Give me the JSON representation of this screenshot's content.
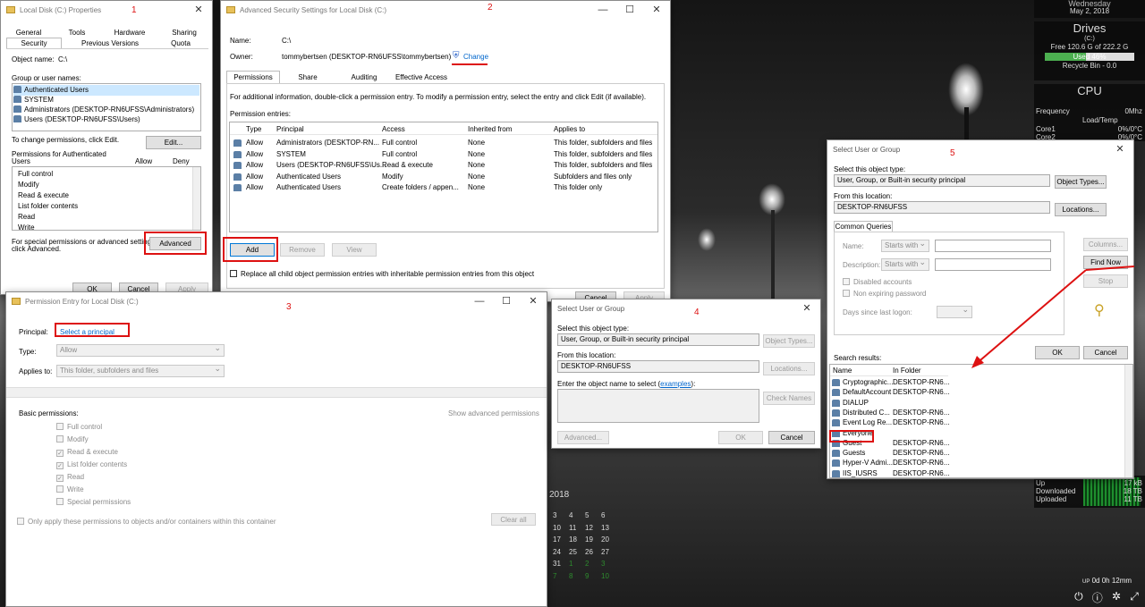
{
  "right_panel": {
    "date_top": "Wednesday",
    "date": "May 2, 2018",
    "drives_title": "Drives",
    "drive_c": "(C:)",
    "drive_free": "Free 120.6 G of 222.2 G",
    "drive_used": "Used 46%",
    "drive_used_pct": 46,
    "recycle": "Recycle Bin - 0.0",
    "cpu_title": "CPU",
    "frequency_label": "Frequency",
    "frequency_value": "0Mhz",
    "load_temp": "Load/Temp",
    "core1_label": "Core1",
    "core1_value": "0%/0°C",
    "core2_label": "Core2",
    "core2_value": "0%/0°C",
    "up_label": "Up",
    "up_value": "17 kB",
    "downloaded_label": "Downloaded",
    "downloaded_value": "18 TB",
    "uploaded_label": "Uploaded",
    "uploaded_value": "11 TB",
    "uptime_prefix": "UP",
    "uptime": "0d 0h 12mm"
  },
  "calendar": {
    "year": "2018",
    "rows": [
      [
        "3",
        "4",
        "5",
        "6"
      ],
      [
        "10",
        "11",
        "12",
        "13"
      ],
      [
        "17",
        "18",
        "19",
        "20"
      ],
      [
        "24",
        "25",
        "26",
        "27"
      ],
      [
        "31",
        "1",
        "2",
        "3"
      ],
      [
        "7",
        "8",
        "9",
        "10"
      ]
    ]
  },
  "annotations": [
    "1",
    "2",
    "3",
    "4",
    "5"
  ],
  "w1": {
    "title": "Local Disk (C:) Properties",
    "tabs_row1": [
      "General",
      "Tools",
      "Hardware",
      "Sharing"
    ],
    "tabs_row2": [
      "Security",
      "Previous Versions",
      "Quota"
    ],
    "object_name_label": "Object name:",
    "object_name": "C:\\",
    "group_label": "Group or user names:",
    "groups": [
      "Authenticated Users",
      "SYSTEM",
      "Administrators (DESKTOP-RN6UFSS\\Administrators)",
      "Users (DESKTOP-RN6UFSS\\Users)"
    ],
    "change_text": "To change permissions, click Edit.",
    "edit": "Edit...",
    "perm_for": "Permissions for Authenticated",
    "perm_for2": "Users",
    "allow": "Allow",
    "deny": "Deny",
    "perms": [
      "Full control",
      "Modify",
      "Read & execute",
      "List folder contents",
      "Read",
      "Write"
    ],
    "special_text": "For special permissions or advanced settings,",
    "special_text2": "click Advanced.",
    "advanced": "Advanced",
    "ok": "OK",
    "cancel": "Cancel",
    "apply": "Apply"
  },
  "w2": {
    "title": "Advanced Security Settings for Local Disk (C:)",
    "name_label": "Name:",
    "name": "C:\\",
    "owner_label": "Owner:",
    "owner": "tommybertsen (DESKTOP-RN6UFSS\\tommybertsen)",
    "change": "Change",
    "tabs": [
      "Permissions",
      "Share",
      "Auditing",
      "Effective Access"
    ],
    "info": "For additional information, double-click a permission entry. To modify a permission entry, select the entry and click Edit (if available).",
    "entries_label": "Permission entries:",
    "columns": [
      "Type",
      "Principal",
      "Access",
      "Inherited from",
      "Applies to"
    ],
    "rows": [
      [
        "Allow",
        "Administrators (DESKTOP-RN...",
        "Full control",
        "None",
        "This folder, subfolders and files"
      ],
      [
        "Allow",
        "SYSTEM",
        "Full control",
        "None",
        "This folder, subfolders and files"
      ],
      [
        "Allow",
        "Users (DESKTOP-RN6UFSS\\Us...",
        "Read & execute",
        "None",
        "This folder, subfolders and files"
      ],
      [
        "Allow",
        "Authenticated Users",
        "Modify",
        "None",
        "Subfolders and files only"
      ],
      [
        "Allow",
        "Authenticated Users",
        "Create folders / appen...",
        "None",
        "This folder only"
      ]
    ],
    "add": "Add",
    "remove": "Remove",
    "view": "View",
    "replace": "Replace all child object permission entries with inheritable permission entries from this object",
    "cancel": "Cancel",
    "apply": "Apply"
  },
  "w3": {
    "title": "Permission Entry for Local Disk (C:)",
    "principal_label": "Principal:",
    "principal_link": "Select a principal",
    "type_label": "Type:",
    "type_value": "Allow",
    "applies_label": "Applies to:",
    "applies_value": "This folder, subfolders and files",
    "basic": "Basic permissions:",
    "show_adv": "Show advanced permissions",
    "perms": [
      "Full control",
      "Modify",
      "Read & execute",
      "List folder contents",
      "Read",
      "Write",
      "Special permissions"
    ],
    "perms_checked": [
      false,
      false,
      true,
      true,
      true,
      false,
      false
    ],
    "only_apply": "Only apply these permissions to objects and/or containers within this container",
    "clear_all": "Clear all"
  },
  "w4": {
    "title": "Select User or Group",
    "obj_type_label": "Select this object type:",
    "obj_type": "User, Group, or Built-in security principal",
    "obj_types_btn": "Object Types...",
    "loc_label": "From this location:",
    "location": "DESKTOP-RN6UFSS",
    "locations_btn": "Locations...",
    "enter_label": "Enter the object name to select (",
    "examples": "examples",
    "enter_end": "):",
    "check_names": "Check Names",
    "advanced": "Advanced...",
    "ok": "OK",
    "cancel": "Cancel"
  },
  "w5": {
    "title": "Select User or Group",
    "obj_type_label": "Select this object type:",
    "obj_type": "User, Group, or Built-in security principal",
    "obj_types_btn": "Object Types...",
    "loc_label": "From this location:",
    "location": "DESKTOP-RN6UFSS",
    "locations_btn": "Locations...",
    "common_tab": "Common Queries",
    "name_label": "Name:",
    "desc_label": "Description:",
    "starts_with": "Starts with",
    "disabled": "Disabled accounts",
    "nonexp": "Non expiring password",
    "days": "Days since last logon:",
    "columns_btn": "Columns...",
    "find_now": "Find Now",
    "stop": "Stop",
    "ok": "OK",
    "cancel": "Cancel",
    "results_label": "Search results:",
    "col_name": "Name",
    "col_folder": "In Folder",
    "results": [
      [
        "Cryptographic...",
        "DESKTOP-RN6..."
      ],
      [
        "DefaultAccount",
        "DESKTOP-RN6..."
      ],
      [
        "DIALUP",
        ""
      ],
      [
        "Distributed C...",
        "DESKTOP-RN6..."
      ],
      [
        "Event Log Re...",
        "DESKTOP-RN6..."
      ],
      [
        "Everyone",
        ""
      ],
      [
        "Guest",
        "DESKTOP-RN6..."
      ],
      [
        "Guests",
        "DESKTOP-RN6..."
      ],
      [
        "Hyper-V Admi...",
        "DESKTOP-RN6..."
      ],
      [
        "IIS_IUSRS",
        "DESKTOP-RN6..."
      ]
    ]
  },
  "colors": {
    "annotation": "#dd1111",
    "link": "#0066cc",
    "accent": "#0078d7"
  }
}
